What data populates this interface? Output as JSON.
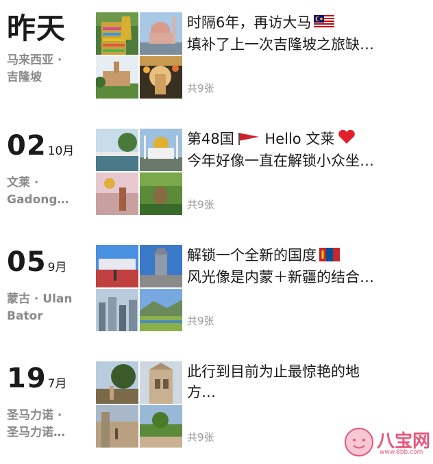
{
  "entries": [
    {
      "date_main": "昨天",
      "location_line1": "马来西亚 ·",
      "location_line2": "吉隆坡",
      "caption_line1": "时隔6年，再访大马",
      "caption_line2": "填补了上一次吉隆坡之旅缺…",
      "count": "共9张",
      "flag_icon": "malaysia-flag-icon"
    },
    {
      "day": "02",
      "month": "10月",
      "location_line1": "文莱 ·",
      "location_line2": "Gadong…",
      "caption_line1": "第48国",
      "caption_line1_suffix": "Hello 文莱",
      "caption_line2": "今年好像一直在解锁小众坐…",
      "count": "共9张",
      "flag_icon": "red-flag-icon",
      "heart_icon": "red-heart-icon"
    },
    {
      "day": "05",
      "month": "9月",
      "location_line1": "蒙古 · Ulan",
      "location_line2": "Bator",
      "caption_line1": "解锁一个全新的国度",
      "caption_line2": "风光像是内蒙＋新疆的结合…",
      "count": "共9张",
      "flag_icon": "mongolia-flag-icon"
    },
    {
      "day": "19",
      "month": "7月",
      "location_line1": "圣马力诺 ·",
      "location_line2": "圣马力诺…",
      "caption_line1": "此行到目前为止最惊艳的地",
      "caption_line2": "方…",
      "count": "共9张"
    }
  ],
  "watermark": {
    "text": "八宝网",
    "sub": "www.8bb.com",
    "icon": "smiling-face-logo-icon"
  },
  "colors": {
    "date_text": "#1a1a1a",
    "location_text": "#8a8a8a",
    "count_text": "#9a9a9a",
    "watermark": "#e8557a"
  }
}
